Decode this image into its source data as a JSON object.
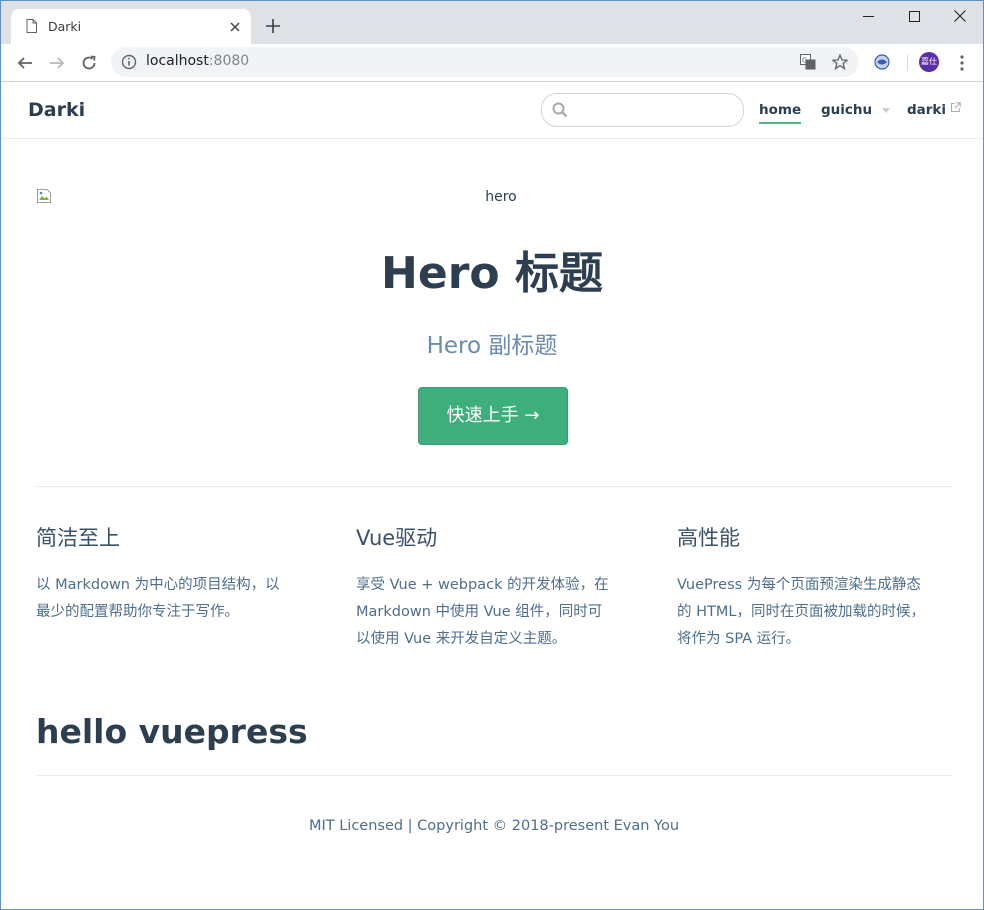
{
  "browser": {
    "tab_title": "Darki",
    "url_host": "localhost",
    "url_port": ":8080",
    "avatar_text": "嘉仕"
  },
  "navbar": {
    "site_name": "Darki",
    "search_placeholder": "",
    "links": [
      {
        "label": "home",
        "active": true
      },
      {
        "label": "guichu",
        "dropdown": true
      },
      {
        "label": "darki",
        "external": true
      }
    ]
  },
  "hero": {
    "image_alt": "hero",
    "title": "Hero 标题",
    "subtitle": "Hero 副标题",
    "action_text": "快速上手 →"
  },
  "features": [
    {
      "title": "简洁至上",
      "details_lines": [
        "以 Markdown 为中心的项目结构，以",
        "最少的配置帮助你专注于写作。"
      ]
    },
    {
      "title": "Vue驱动",
      "details_lines": [
        "享受 Vue + webpack 的开发体验，在",
        "Markdown 中使用 Vue 组件，同时可",
        "以使用 Vue 来开发自定义主题。"
      ]
    },
    {
      "title": "高性能",
      "details_lines": [
        "VuePress 为每个页面预渲染生成静态",
        "的 HTML，同时在页面被加载的时候，",
        "将作为 SPA 运行。"
      ]
    }
  ],
  "content": {
    "heading": "hello vuepress"
  },
  "footer": {
    "text": "MIT Licensed | Copyright © 2018-present Evan You"
  },
  "colors": {
    "accent": "#3eaf7c",
    "text": "#2c3e50",
    "subtitle": "#6a8bad",
    "window_border": "#5f8fc5"
  }
}
